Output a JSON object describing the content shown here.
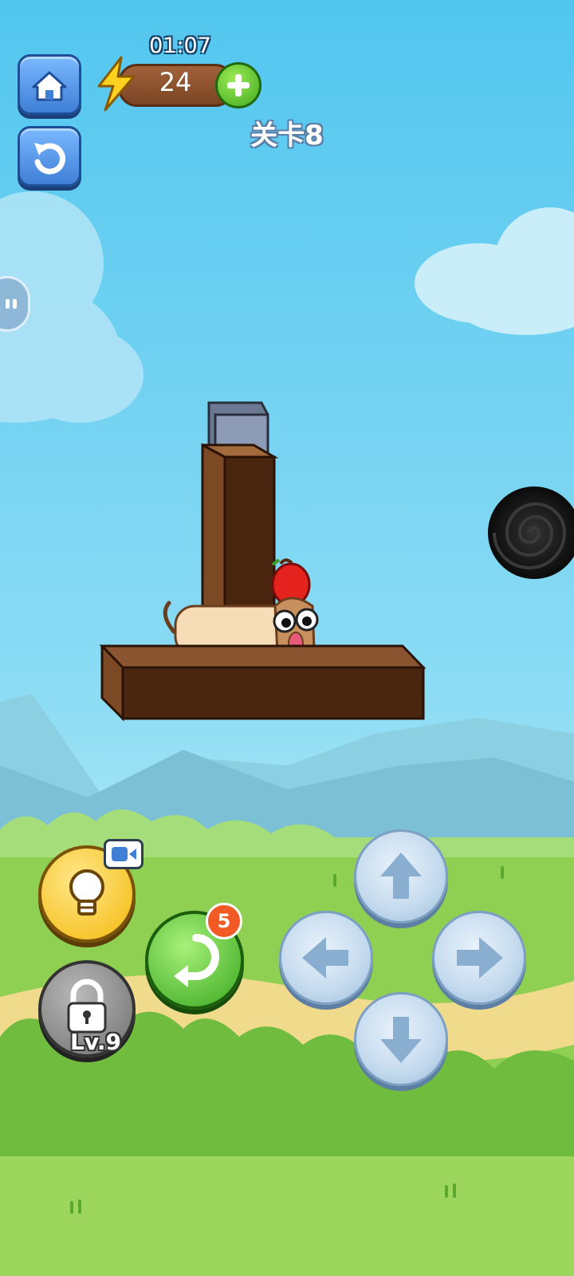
{
  "hud": {
    "timer": "01:07",
    "energy": "24",
    "level_label": "关卡8"
  },
  "buttons": {
    "hint_locked_level": "Lv.9",
    "undo_count": "5"
  },
  "icons": {
    "home": "home-icon",
    "restart": "restart-icon",
    "energy": "lightning-bolt-icon",
    "add_energy": "plus-icon",
    "hint": "light-bulb-icon",
    "video_ad": "video-camera-icon",
    "lock": "lock-icon",
    "undo": "undo-arrow-icon",
    "up": "arrow-up-icon",
    "down": "arrow-down-icon",
    "left": "arrow-left-icon",
    "right": "arrow-right-icon"
  },
  "colors": {
    "sky_top": "#56c8f0",
    "sky_bottom": "#a9e7f6",
    "grass": "#8fd14f",
    "wood": "#4a2510",
    "apple": "#e4231f",
    "portal": "#111111"
  }
}
